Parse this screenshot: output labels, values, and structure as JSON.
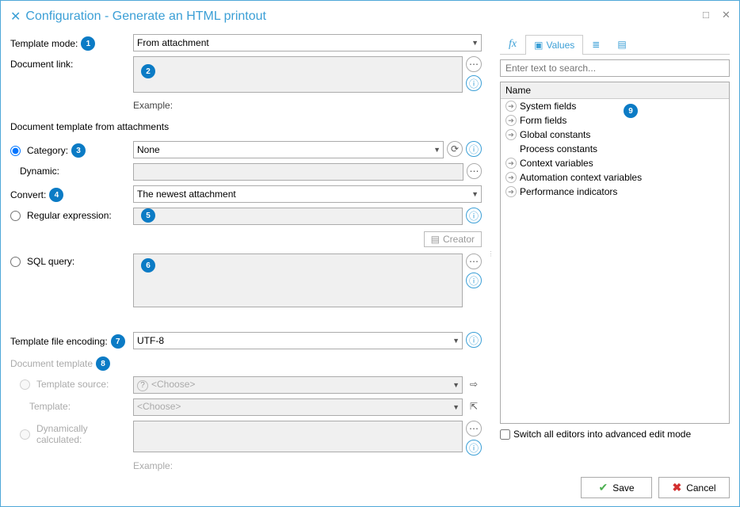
{
  "window": {
    "title": "Configuration - Generate an HTML printout"
  },
  "labels": {
    "template_mode": "Template mode:",
    "document_link": "Document link:",
    "example": "Example:",
    "doc_template_attach": "Document template from attachments",
    "category": "Category:",
    "dynamic": "Dynamic:",
    "convert": "Convert:",
    "regex": "Regular expression:",
    "sql": "SQL query:",
    "encoding": "Template file encoding:",
    "doc_template": "Document template",
    "template_source": "Template source:",
    "template": "Template:",
    "dyn_calc": "Dynamically calculated:",
    "creator": "Creator",
    "choose": "<Choose>"
  },
  "values": {
    "template_mode": "From attachment",
    "category": "None",
    "convert": "The newest attachment",
    "encoding": "UTF-8"
  },
  "right": {
    "tabs": {
      "values": "Values"
    },
    "search_placeholder": "Enter text to search...",
    "name_header": "Name",
    "items": [
      "System fields",
      "Form fields",
      "Global constants",
      "Process constants",
      "Context variables",
      "Automation context variables",
      "Performance indicators"
    ],
    "switch_label": "Switch all editors into advanced edit mode"
  },
  "footer": {
    "save": "Save",
    "cancel": "Cancel"
  },
  "badges": [
    "1",
    "2",
    "3",
    "4",
    "5",
    "6",
    "7",
    "8",
    "9"
  ]
}
